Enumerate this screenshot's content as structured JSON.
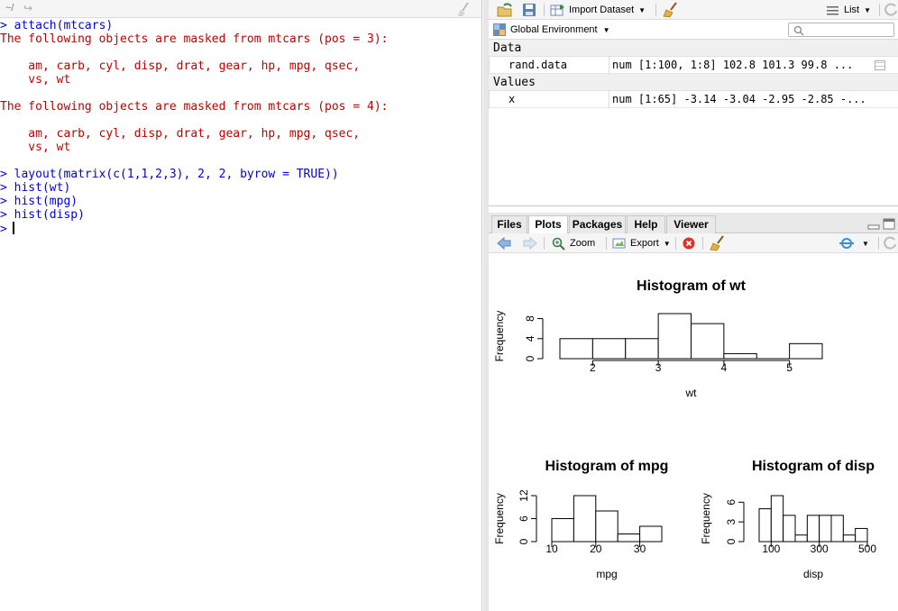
{
  "console": {
    "path": "~/",
    "lines": [
      {
        "type": "cmd",
        "text": "> attach(mtcars)"
      },
      {
        "type": "msg",
        "text": "The following objects are masked from mtcars (pos = 3):"
      },
      {
        "type": "msg",
        "text": ""
      },
      {
        "type": "msg",
        "text": "    am, carb, cyl, disp, drat, gear, hp, mpg, qsec,"
      },
      {
        "type": "msg",
        "text": "    vs, wt"
      },
      {
        "type": "msg",
        "text": ""
      },
      {
        "type": "msg",
        "text": "The following objects are masked from mtcars (pos = 4):"
      },
      {
        "type": "msg",
        "text": ""
      },
      {
        "type": "msg",
        "text": "    am, carb, cyl, disp, drat, gear, hp, mpg, qsec,"
      },
      {
        "type": "msg",
        "text": "    vs, wt"
      },
      {
        "type": "msg",
        "text": ""
      },
      {
        "type": "cmd",
        "text": "> layout(matrix(c(1,1,2,3), 2, 2, byrow = TRUE))"
      },
      {
        "type": "cmd",
        "text": "> hist(wt)"
      },
      {
        "type": "cmd",
        "text": "> hist(mpg)"
      },
      {
        "type": "cmd",
        "text": "> hist(disp)"
      }
    ],
    "prompt": ">"
  },
  "environment": {
    "import_label": "Import Dataset",
    "view_label": "List",
    "scope_label": "Global Environment",
    "search_placeholder": "",
    "sections": [
      {
        "title": "Data",
        "rows": [
          {
            "name": "rand.data",
            "value": "num [1:100, 1:8] 102.8 101.3 99.8 ..."
          }
        ]
      },
      {
        "title": "Values",
        "rows": [
          {
            "name": "x",
            "value": "num [1:65] -3.14 -3.04 -2.95 -2.85 -..."
          }
        ]
      }
    ]
  },
  "plots_pane": {
    "tabs": [
      "Files",
      "Plots",
      "Packages",
      "Help",
      "Viewer"
    ],
    "active_tab": "Plots",
    "zoom_label": "Zoom",
    "export_label": "Export"
  },
  "chart_data": [
    {
      "type": "bar",
      "title": "Histogram of wt",
      "xlabel": "wt",
      "ylabel": "Frequency",
      "bins": [
        [
          1.5,
          2.0
        ],
        [
          2.0,
          2.5
        ],
        [
          2.5,
          3.0
        ],
        [
          3.0,
          3.5
        ],
        [
          3.5,
          4.0
        ],
        [
          4.0,
          4.5
        ],
        [
          4.5,
          5.0
        ],
        [
          5.0,
          5.5
        ]
      ],
      "values": [
        4,
        4,
        4,
        9,
        7,
        1,
        0,
        3
      ],
      "xticks": [
        2,
        3,
        4,
        5
      ],
      "yticks": [
        0,
        4,
        8
      ],
      "xlim": [
        1.5,
        5.5
      ],
      "ylim": [
        0,
        9
      ]
    },
    {
      "type": "bar",
      "title": "Histogram of mpg",
      "xlabel": "mpg",
      "ylabel": "Frequency",
      "bins": [
        [
          10,
          15
        ],
        [
          15,
          20
        ],
        [
          20,
          25
        ],
        [
          25,
          30
        ],
        [
          30,
          35
        ]
      ],
      "values": [
        6,
        12,
        8,
        2,
        4
      ],
      "xticks": [
        10,
        20,
        30
      ],
      "yticks": [
        0,
        6,
        12
      ],
      "xlim": [
        10,
        35
      ],
      "ylim": [
        0,
        12
      ]
    },
    {
      "type": "bar",
      "title": "Histogram of disp",
      "xlabel": "disp",
      "ylabel": "Frequency",
      "bins": [
        [
          50,
          100
        ],
        [
          100,
          150
        ],
        [
          150,
          200
        ],
        [
          200,
          250
        ],
        [
          250,
          300
        ],
        [
          300,
          350
        ],
        [
          350,
          400
        ],
        [
          400,
          450
        ],
        [
          450,
          500
        ]
      ],
      "values": [
        5,
        7,
        4,
        1,
        4,
        4,
        4,
        1,
        2
      ],
      "xticks": [
        100,
        300,
        500
      ],
      "yticks": [
        0,
        3,
        6
      ],
      "xlim": [
        50,
        500
      ],
      "ylim": [
        0,
        7
      ]
    }
  ]
}
